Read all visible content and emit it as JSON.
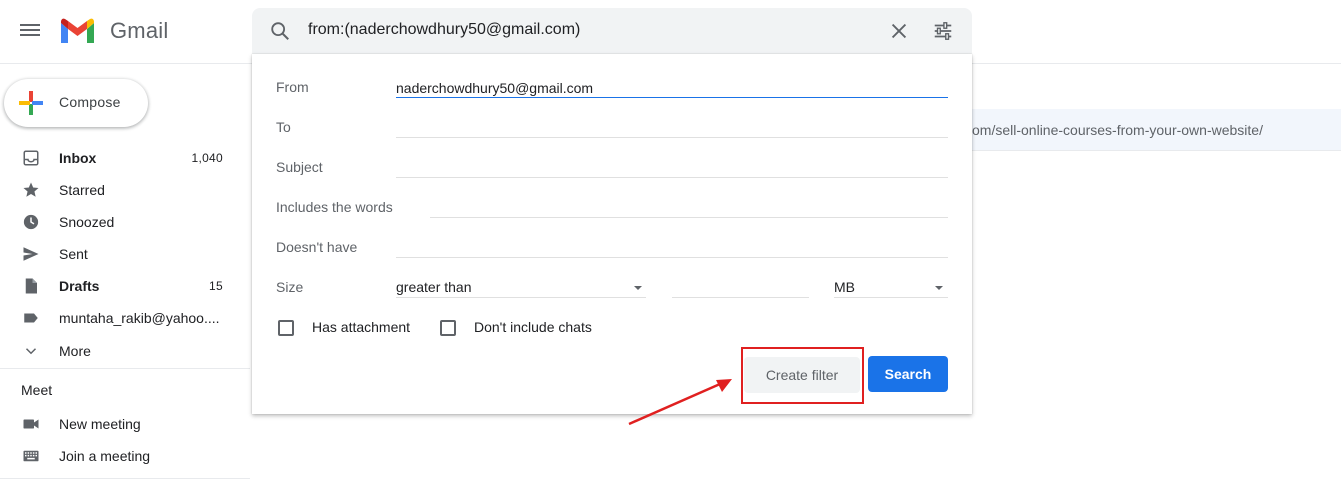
{
  "header": {
    "app_name": "Gmail",
    "menu_icon": "hamburger-menu-icon",
    "logo_icon": "gmail-logo-icon"
  },
  "search": {
    "query": "from:(naderchowdhury50@gmail.com)",
    "search_icon": "search-icon",
    "clear_icon": "close-icon",
    "options_icon": "tune-icon"
  },
  "compose": {
    "label": "Compose"
  },
  "sidebar": {
    "items": [
      {
        "label": "Inbox",
        "count": "1,040",
        "icon": "inbox-icon",
        "bold": true
      },
      {
        "label": "Starred",
        "count": "",
        "icon": "star-icon",
        "bold": false
      },
      {
        "label": "Snoozed",
        "count": "",
        "icon": "clock-icon",
        "bold": false
      },
      {
        "label": "Sent",
        "count": "",
        "icon": "send-icon",
        "bold": false
      },
      {
        "label": "Drafts",
        "count": "15",
        "icon": "draft-icon",
        "bold": true
      },
      {
        "label": "muntaha_rakib@yahoo....",
        "count": "",
        "icon": "label-icon",
        "bold": false
      },
      {
        "label": "More",
        "count": "",
        "icon": "chevron-down-icon",
        "bold": false
      }
    ],
    "meet": {
      "heading": "Meet",
      "items": [
        {
          "label": "New meeting",
          "icon": "video-camera-icon"
        },
        {
          "label": "Join a meeting",
          "icon": "keyboard-icon"
        }
      ]
    }
  },
  "background_row": {
    "text": "om/sell-online-courses-from-your-own-website/"
  },
  "advanced_search": {
    "from_label": "From",
    "from_value": "naderchowdhury50@gmail.com",
    "to_label": "To",
    "to_value": "",
    "subject_label": "Subject",
    "subject_value": "",
    "includes_label": "Includes the words",
    "includes_value": "",
    "doesnt_have_label": "Doesn't have",
    "doesnt_have_value": "",
    "size_label": "Size",
    "size_operator": "greater than",
    "size_value": "",
    "size_unit": "MB",
    "has_attachment_label": "Has attachment",
    "has_attachment_checked": false,
    "no_chats_label": "Don't include chats",
    "no_chats_checked": false,
    "create_filter_label": "Create filter",
    "search_label": "Search"
  },
  "annotation": {
    "highlight_color": "#e02020"
  },
  "colors": {
    "primary_blue": "#1a73e8",
    "text": "#202124",
    "muted": "#5f6368"
  }
}
